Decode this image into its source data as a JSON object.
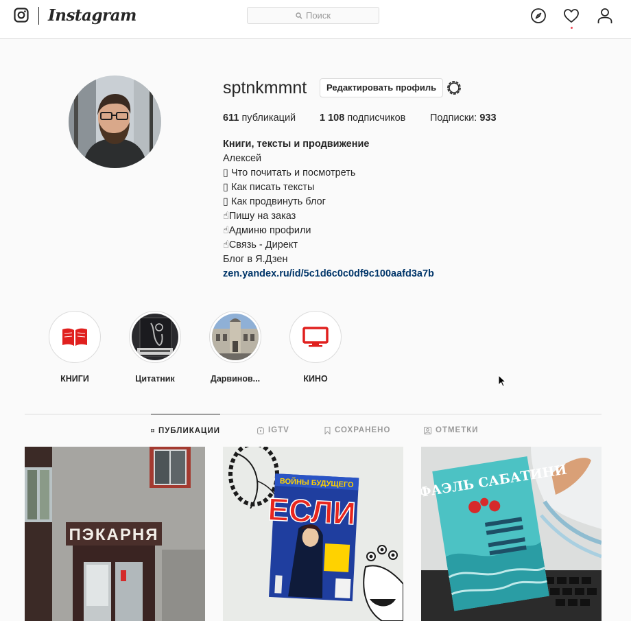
{
  "nav": {
    "wordmark": "Instagram",
    "search_placeholder": "Поиск",
    "icons": [
      "instagram-glyph-icon",
      "search-icon",
      "explore-compass-icon",
      "activity-heart-icon",
      "profile-person-icon"
    ]
  },
  "profile": {
    "username": "sptnkmmnt",
    "edit_button": "Редактировать профиль",
    "stats": {
      "posts_count": "611",
      "posts_label": "публикаций",
      "followers_count": "1 108",
      "followers_label": "подписчиков",
      "following_label": "Подписки:",
      "following_count": "933"
    },
    "bio": {
      "name": "Книги, тексты и продвижение",
      "lines": [
        "Алексей",
        "▯ Что почитать и посмотреть",
        "▯ Как писать тексты",
        "▯ Как продвинуть блог",
        "☝Пишу на заказ",
        "☝Админю профили",
        "☝Связь - Директ",
        "Блог в Я.Дзен"
      ],
      "link": "zen.yandex.ru/id/5c1d6c0c0df9c100aafd3a7b"
    }
  },
  "highlights": [
    {
      "label": "КНИГИ",
      "cover": "red-book-icon"
    },
    {
      "label": "Цитатник",
      "cover": "photo-book-cover"
    },
    {
      "label": "Дарвинов...",
      "cover": "photo-building"
    },
    {
      "label": "КИНО",
      "cover": "red-tv-icon"
    }
  ],
  "tabs": [
    {
      "label": "ПУБЛИКАЦИИ",
      "icon": "grid-icon",
      "active": true
    },
    {
      "label": "IGTV",
      "icon": "igtv-icon",
      "active": false
    },
    {
      "label": "СОХРАНЕНО",
      "icon": "bookmark-icon",
      "active": false
    },
    {
      "label": "ОТМЕТКИ",
      "icon": "tagged-icon",
      "active": false
    }
  ],
  "posts": [
    {
      "caption_text": "ПЭКАРНЯ"
    },
    {
      "caption_text": "ЕСЛИ",
      "subtitle": "ВОЙНЫ БУДУЩЕГО"
    },
    {
      "caption_text": "РАФАЭЛЬ САБАТИНИ"
    }
  ],
  "colors": {
    "accent_red": "#ed4956",
    "highlight_red": "#e0201e",
    "link_blue": "#003569",
    "border": "#dbdbdb"
  }
}
